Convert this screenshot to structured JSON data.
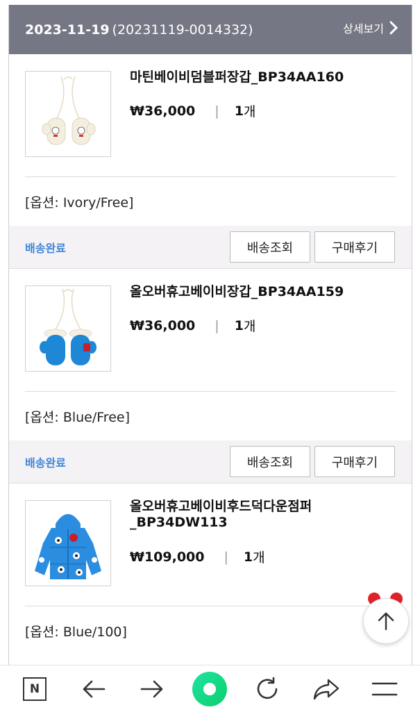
{
  "order": {
    "date": "2023-11-19",
    "number": "(20231119-0014332)",
    "detail_label": "상세보기"
  },
  "items": [
    {
      "name": "마틴베이비덤블퍼장갑_BP34AA160",
      "price": "₩36,000",
      "qty_num": "1",
      "qty_unit": "개",
      "option": "[옵션: Ivory/Free]",
      "status": "배송완료",
      "btn_track": "배송조회",
      "btn_review": "구매후기",
      "image_icon": "ivory-mittens-icon",
      "color": "#f2ede0"
    },
    {
      "name": "올오버휴고베이비장갑_BP34AA159",
      "price": "₩36,000",
      "qty_num": "1",
      "qty_unit": "개",
      "option": "[옵션: Blue/Free]",
      "status": "배송완료",
      "btn_track": "배송조회",
      "btn_review": "구매후기",
      "image_icon": "blue-mittens-icon",
      "color": "#1f88d6"
    },
    {
      "name": "올오버휴고베이비후드덕다운점퍼\n_BP34DW113",
      "price": "₩109,000",
      "qty_num": "1",
      "qty_unit": "개",
      "option": "[옵션: Blue/100]",
      "image_icon": "blue-down-jacket-icon",
      "color": "#2a8de0"
    }
  ],
  "nav": [
    "naver-n-icon",
    "back-arrow-icon",
    "forward-arrow-icon",
    "green-home-icon",
    "refresh-icon",
    "share-icon",
    "menu-icon"
  ],
  "colors": {
    "header_bg": "#767784",
    "status": "#3f86d6",
    "status_bg": "#f5f2f6"
  }
}
